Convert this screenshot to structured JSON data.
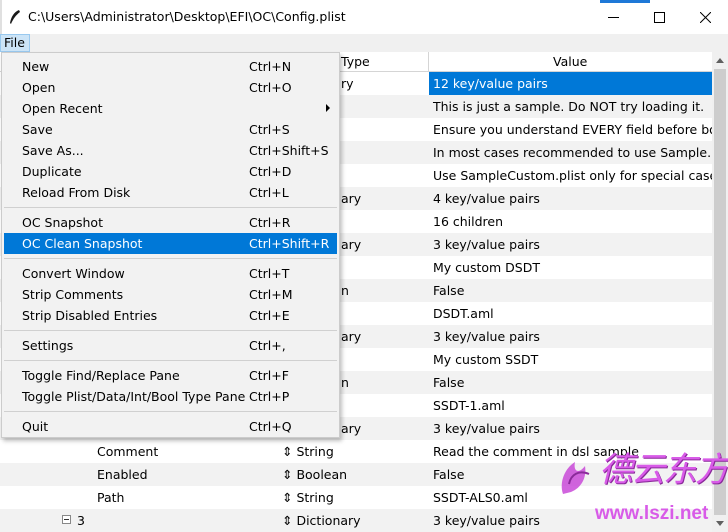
{
  "window": {
    "title": "C:\\Users\\Administrator\\Desktop\\EFI\\OC\\Config.plist"
  },
  "menubar": {
    "file_label": "File"
  },
  "header": {
    "type": "Type",
    "value": "Value"
  },
  "rows": [
    {
      "key": "",
      "type": "ry",
      "value": "12 key/value pairs",
      "selected": true
    },
    {
      "key": "",
      "type": "",
      "value": "This is just a sample. Do NOT try loading it."
    },
    {
      "key": "",
      "type": "",
      "value": "Ensure you understand EVERY field before booting."
    },
    {
      "key": "",
      "type": "",
      "value": "In most cases recommended to use Sample.plist"
    },
    {
      "key": "",
      "type": "",
      "value": "Use SampleCustom.plist only for special cases."
    },
    {
      "key": "",
      "type": "ary",
      "value": "4 key/value pairs"
    },
    {
      "key": "",
      "type": "",
      "value": "16 children"
    },
    {
      "key": "",
      "type": "ary",
      "value": "3 key/value pairs"
    },
    {
      "key": "",
      "type": "",
      "value": "My custom DSDT"
    },
    {
      "key": "",
      "type": "n",
      "value": "False"
    },
    {
      "key": "",
      "type": "",
      "value": "DSDT.aml"
    },
    {
      "key": "",
      "type": "ary",
      "value": "3 key/value pairs"
    },
    {
      "key": "",
      "type": "",
      "value": "My custom SSDT"
    },
    {
      "key": "",
      "type": "n",
      "value": "False"
    },
    {
      "key": "",
      "type": "",
      "value": "SSDT-1.aml"
    },
    {
      "key": "",
      "type": "ary",
      "value": "3 key/value pairs"
    },
    {
      "key": "Comment",
      "type": "⇕ String",
      "value": "Read the comment in dsl sample"
    },
    {
      "key": "Enabled",
      "type": "⇕ Boolean",
      "value": "False"
    },
    {
      "key": "Path",
      "type": "⇕ String",
      "value": "SSDT-ALS0.aml"
    },
    {
      "key": "3",
      "type": "⇕ Dictionary",
      "value": "3 key/value pairs"
    }
  ],
  "file_menu": {
    "items": [
      {
        "label": "New",
        "accel": "Ctrl+N"
      },
      {
        "label": "Open",
        "accel": "Ctrl+O"
      },
      {
        "label": "Open Recent",
        "accel": "",
        "submenu": true
      },
      {
        "label": "Save",
        "accel": "Ctrl+S"
      },
      {
        "label": "Save As...",
        "accel": "Ctrl+Shift+S"
      },
      {
        "label": "Duplicate",
        "accel": "Ctrl+D"
      },
      {
        "label": "Reload From Disk",
        "accel": "Ctrl+L"
      },
      {
        "label": "OC Snapshot",
        "accel": "Ctrl+R"
      },
      {
        "label": "OC Clean Snapshot",
        "accel": "Ctrl+Shift+R",
        "highlighted": true
      },
      {
        "label": "Convert Window",
        "accel": "Ctrl+T"
      },
      {
        "label": "Strip Comments",
        "accel": "Ctrl+M"
      },
      {
        "label": "Strip Disabled Entries",
        "accel": "Ctrl+E"
      },
      {
        "label": "Settings",
        "accel": "Ctrl+,"
      },
      {
        "label": "Toggle Find/Replace Pane",
        "accel": "Ctrl+F"
      },
      {
        "label": "Toggle Plist/Data/Int/Bool Type Pane",
        "accel": "Ctrl+P"
      },
      {
        "label": "Quit",
        "accel": "Ctrl+Q"
      }
    ]
  },
  "watermark": {
    "text": "德云东方",
    "url": "www.lszi.net"
  },
  "colors": {
    "selection": "#0078d7",
    "menu_bg": "#f2f2f2",
    "watermark": "#d85be8"
  }
}
